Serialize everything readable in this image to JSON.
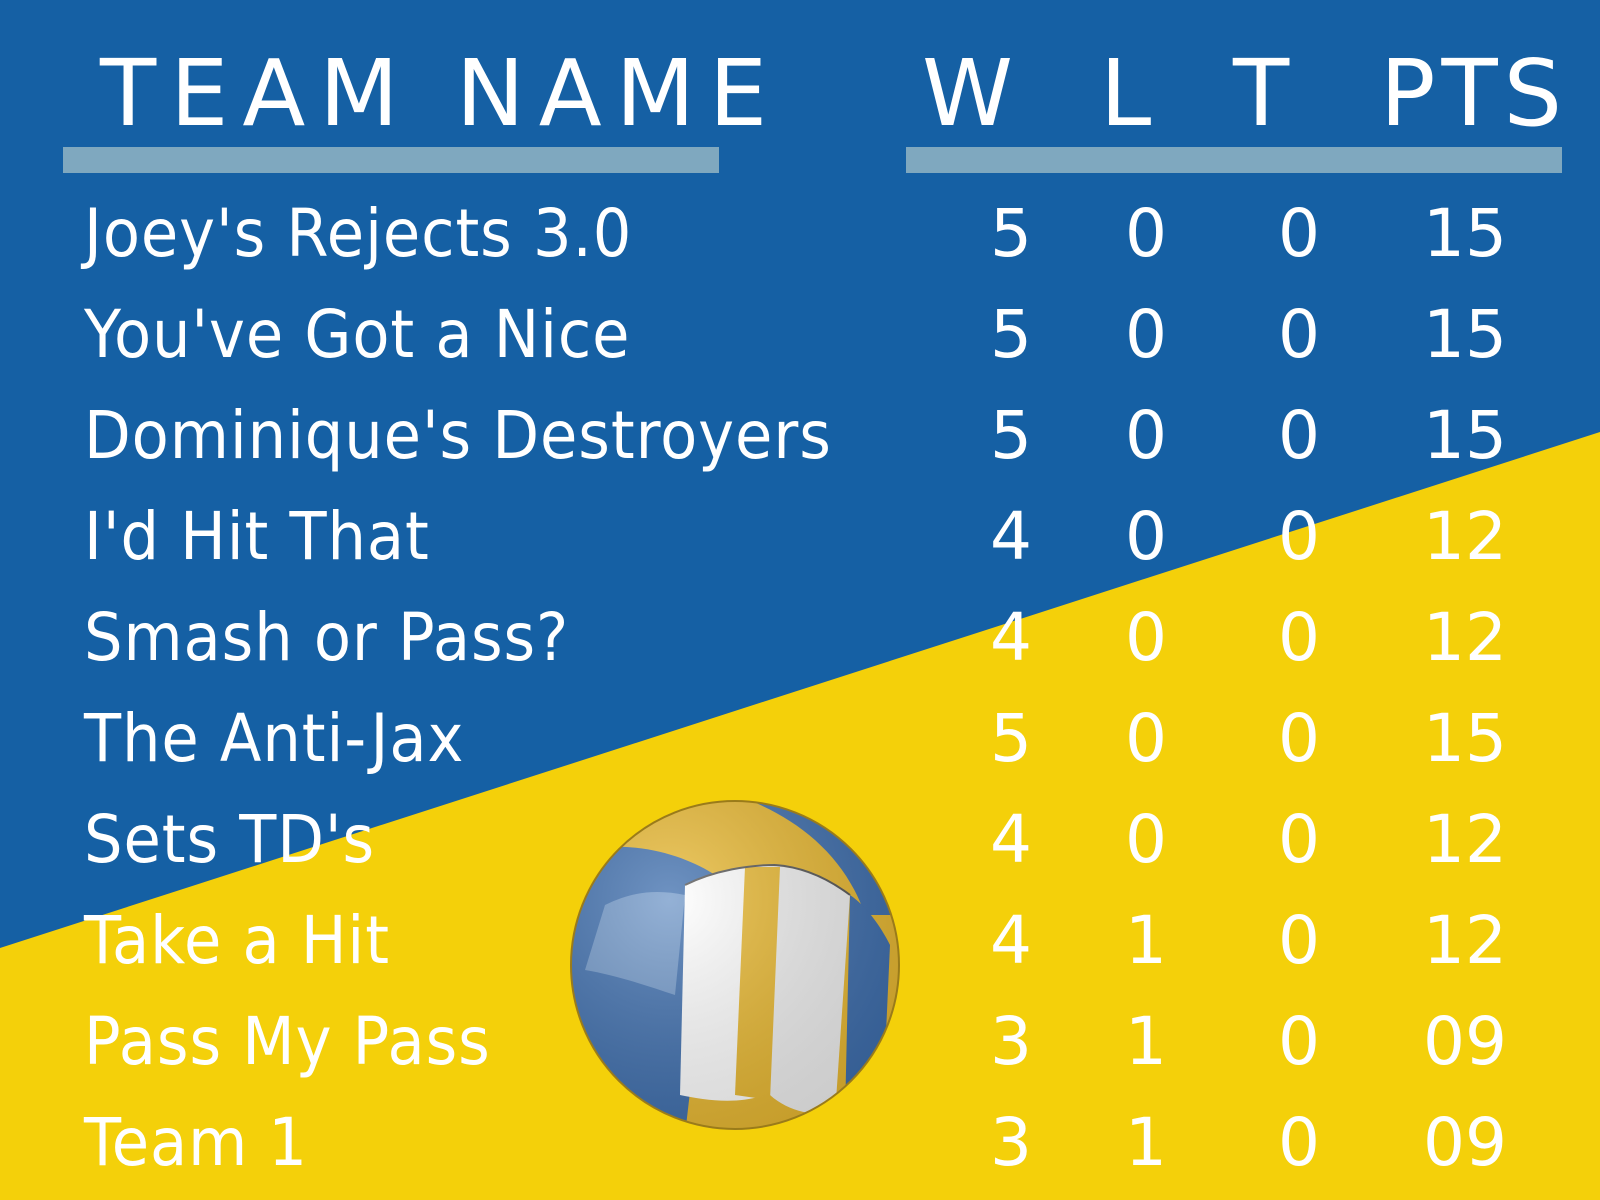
{
  "colors": {
    "background_top": "#1560a4",
    "background_bottom": "#f4d00a",
    "rule": "#7fa8bf",
    "text": "#ffffff"
  },
  "headers": {
    "team_name": "TEAM NAME",
    "wins": "W",
    "losses": "L",
    "ties": "T",
    "points": "PTS"
  },
  "standings": [
    {
      "team": "Joey's Rejects 3.0",
      "w": "5",
      "l": "0",
      "t": "0",
      "pts": "15"
    },
    {
      "team": "You've Got a Nice",
      "w": "5",
      "l": "0",
      "t": "0",
      "pts": "15"
    },
    {
      "team": "Dominique's Destroyers",
      "w": "5",
      "l": "0",
      "t": "0",
      "pts": "15"
    },
    {
      "team": "I'd Hit That",
      "w": "4",
      "l": "0",
      "t": "0",
      "pts": "12"
    },
    {
      "team": "Smash or Pass?",
      "w": "4",
      "l": "0",
      "t": "0",
      "pts": "12"
    },
    {
      "team": "The Anti-Jax",
      "w": "5",
      "l": "0",
      "t": "0",
      "pts": "15"
    },
    {
      "team": "Sets TD's",
      "w": "4",
      "l": "0",
      "t": "0",
      "pts": "12"
    },
    {
      "team": "Take a Hit",
      "w": "4",
      "l": "1",
      "t": "0",
      "pts": "12"
    },
    {
      "team": "Pass My Pass",
      "w": "3",
      "l": "1",
      "t": "0",
      "pts": "09"
    },
    {
      "team": "Team 1",
      "w": "3",
      "l": "1",
      "t": "0",
      "pts": "09"
    }
  ],
  "icons": {
    "ball": "volleyball-icon"
  }
}
